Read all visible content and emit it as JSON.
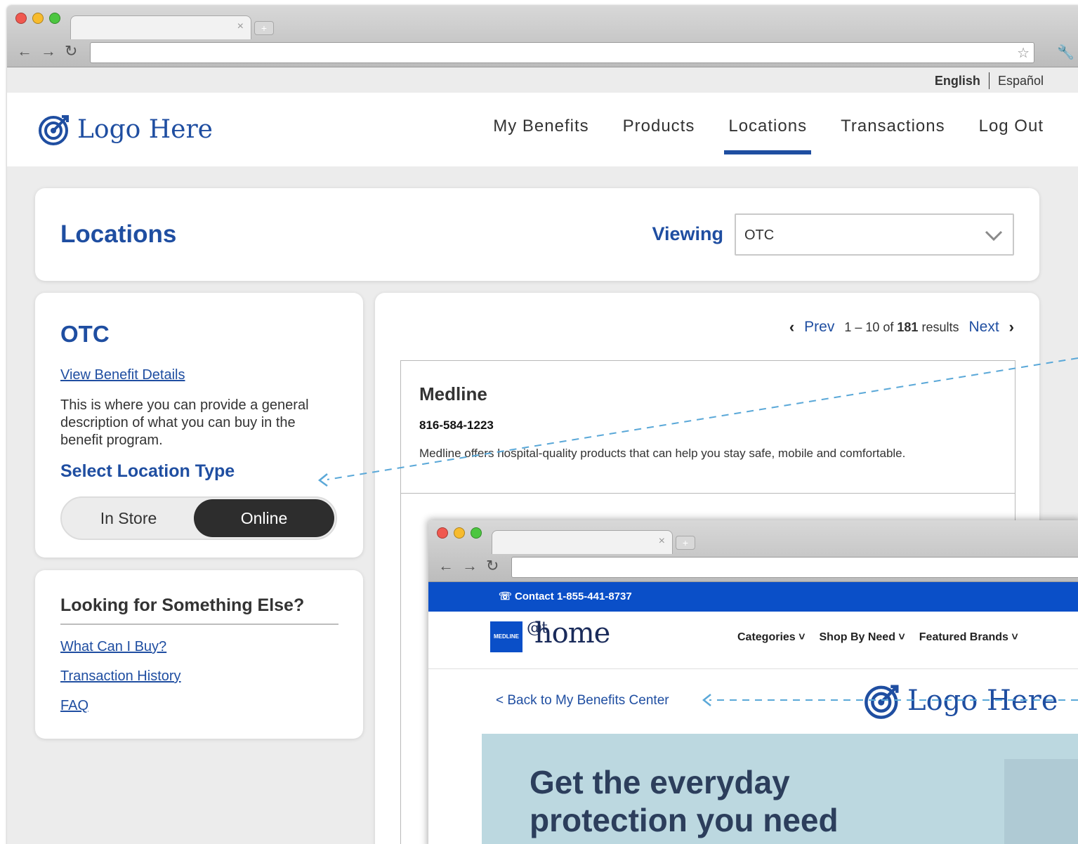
{
  "language": {
    "active": "English",
    "other": "Español"
  },
  "brand": {
    "logo_text": "Logo Here"
  },
  "nav": {
    "items": [
      "My Benefits",
      "Products",
      "Locations",
      "Transactions",
      "Log Out"
    ],
    "active": "Locations"
  },
  "page": {
    "title": "Locations",
    "viewing_label": "Viewing",
    "viewing_value": "OTC"
  },
  "benefit": {
    "title": "OTC",
    "details_link": "View Benefit Details",
    "description": "This is where you can provide a general description of what you can buy in the benefit program.",
    "select_type_label": "Select Location Type",
    "types": [
      "In Store",
      "Online"
    ],
    "selected_type": "Online"
  },
  "help": {
    "title": "Looking for Something Else?",
    "links": [
      "What Can I Buy?",
      "Transaction History",
      "FAQ"
    ]
  },
  "pager": {
    "prev": "Prev",
    "range_prefix": "1 – 10 of",
    "total": "181",
    "range_suffix": "results",
    "next": "Next"
  },
  "results": [
    {
      "name": "Medline",
      "phone": "816-584-1223",
      "description": "Medline offers hospital-quality products that can help you stay safe, mobile and comfortable."
    }
  ],
  "medline_site": {
    "contact": "Contact  1-855-441-8737",
    "badge": "MEDLINE",
    "logo_at": "@t",
    "logo_home": "home",
    "nav": [
      "Categories",
      "Shop By Need",
      "Featured Brands"
    ],
    "back_link": "< Back to My Benefits Center",
    "hero_line1": "Get the everyday",
    "hero_line2": "protection you need"
  },
  "colors": {
    "brand_blue": "#1f4ea1",
    "medline_blue": "#0a4fc8",
    "toggle_active": "#2d2d2d",
    "annotation": "#5aa8d8"
  }
}
